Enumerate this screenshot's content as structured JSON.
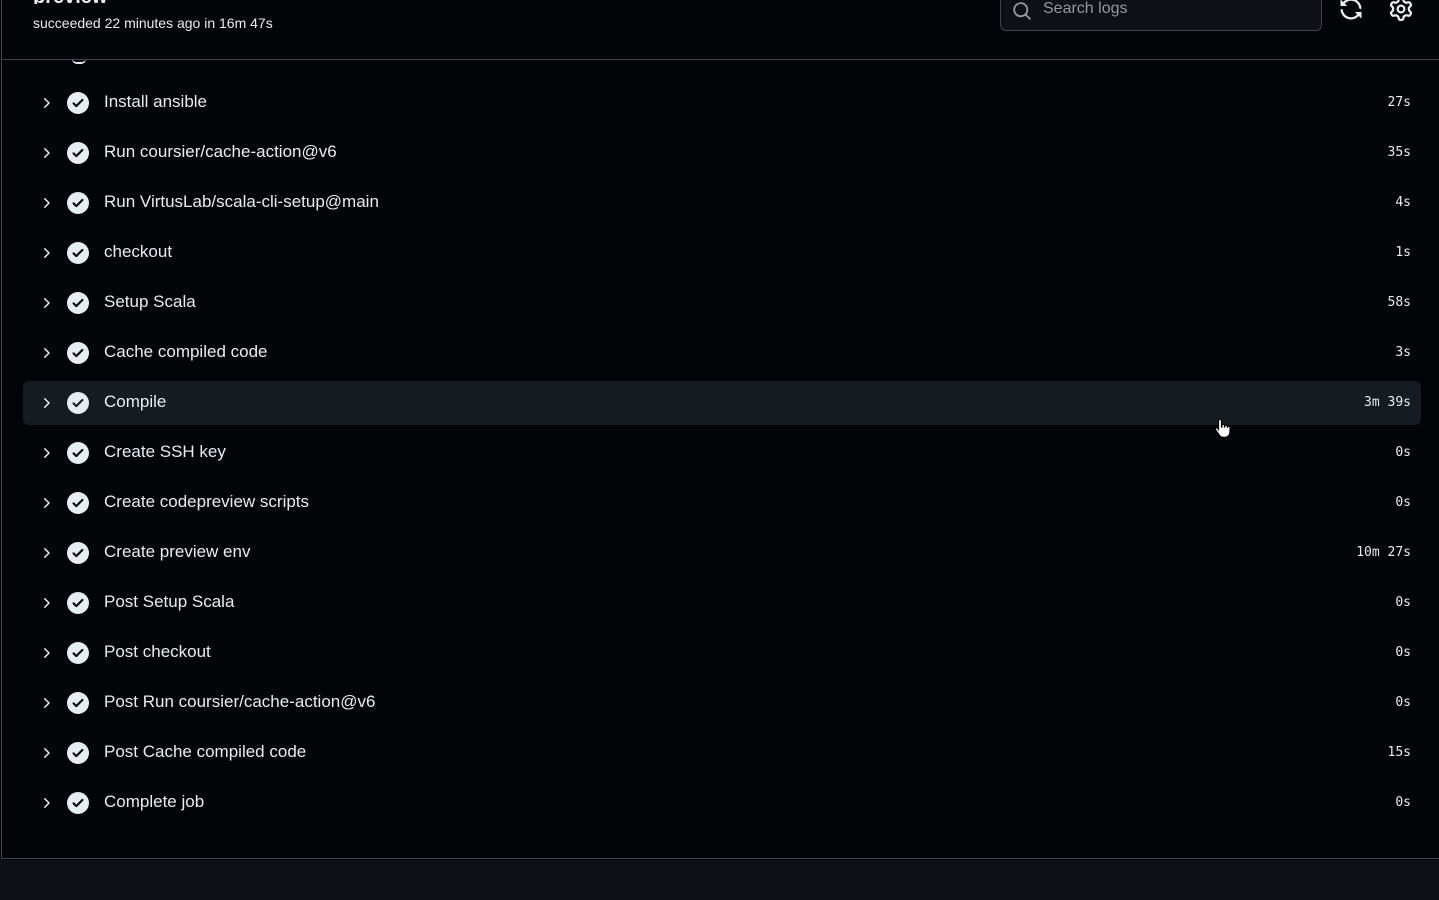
{
  "job": {
    "title": "preview",
    "status": "succeeded 22 minutes ago in 16m 47s"
  },
  "search": {
    "placeholder": "Search logs",
    "value": ""
  },
  "icons": {
    "search": "search-icon",
    "refresh": "sync-icon",
    "settings": "gear-icon",
    "expand": "chevron-right-icon",
    "success": "check-circle-fill-icon"
  },
  "colors": {
    "background": "#010409",
    "text": "#e6edf3",
    "border": "#3d444d",
    "hover_row": "#151b23"
  },
  "steps": [
    {
      "name": "Install ansible",
      "duration": "27s"
    },
    {
      "name": "Run coursier/cache-action@v6",
      "duration": "35s"
    },
    {
      "name": "Run VirtusLab/scala-cli-setup@main",
      "duration": "4s"
    },
    {
      "name": "checkout",
      "duration": "1s"
    },
    {
      "name": "Setup Scala",
      "duration": "58s"
    },
    {
      "name": "Cache compiled code",
      "duration": "3s"
    },
    {
      "name": "Compile",
      "duration": "3m 39s"
    },
    {
      "name": "Create SSH key",
      "duration": "0s"
    },
    {
      "name": "Create codepreview scripts",
      "duration": "0s"
    },
    {
      "name": "Create preview env",
      "duration": "10m 27s"
    },
    {
      "name": "Post Setup Scala",
      "duration": "0s"
    },
    {
      "name": "Post checkout",
      "duration": "0s"
    },
    {
      "name": "Post Run coursier/cache-action@v6",
      "duration": "0s"
    },
    {
      "name": "Post Cache compiled code",
      "duration": "15s"
    },
    {
      "name": "Complete job",
      "duration": "0s"
    }
  ]
}
